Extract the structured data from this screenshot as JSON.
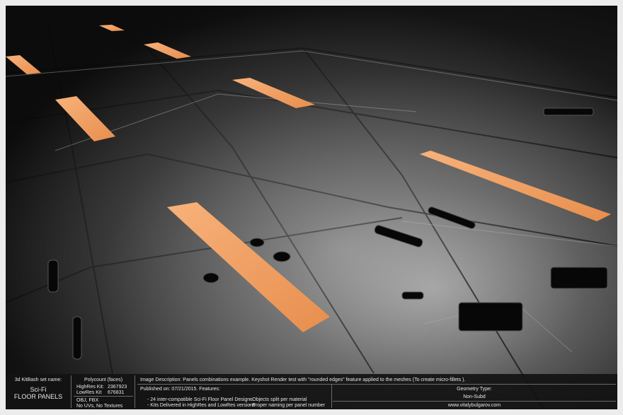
{
  "info_bar": {
    "set_label": "3d KitBash set name:",
    "set_name_line1": "Sci-Fi",
    "set_name_line2": "FLOOR PANELS",
    "polycount_label": "Polycount (faces)",
    "highres_label": "HighRes Kit:",
    "highres_value": "2367923",
    "lowres_label": "LowRes Kit",
    "lowres_value": "676831",
    "formats": "OBJ, FBX",
    "uvs": "No UVs, No Textures",
    "description": "Image Description: Panels combinations example. Keyshot Render test with \"rounded edges\" feature applied to the meshes (To create micro-fillets ).",
    "published": "Published on: 07/21/2015. Features:",
    "feature1": "-   24 inter-compatible Sci-Fi Floor Panel Designs",
    "feature2": "-   Kits Delivered in HighRes and LowRes versions",
    "feature3": "-   Objects split per material",
    "feature4": "-   Proper naming per panel number",
    "geometry_label": "Geometry Type:",
    "geometry_value": "Non-Subd",
    "website": "www.vitalybulgarov.com"
  },
  "colors": {
    "accent_orange": "#f0a060",
    "panel_dark": "#2a2a2a",
    "bar_bg": "#121212"
  }
}
